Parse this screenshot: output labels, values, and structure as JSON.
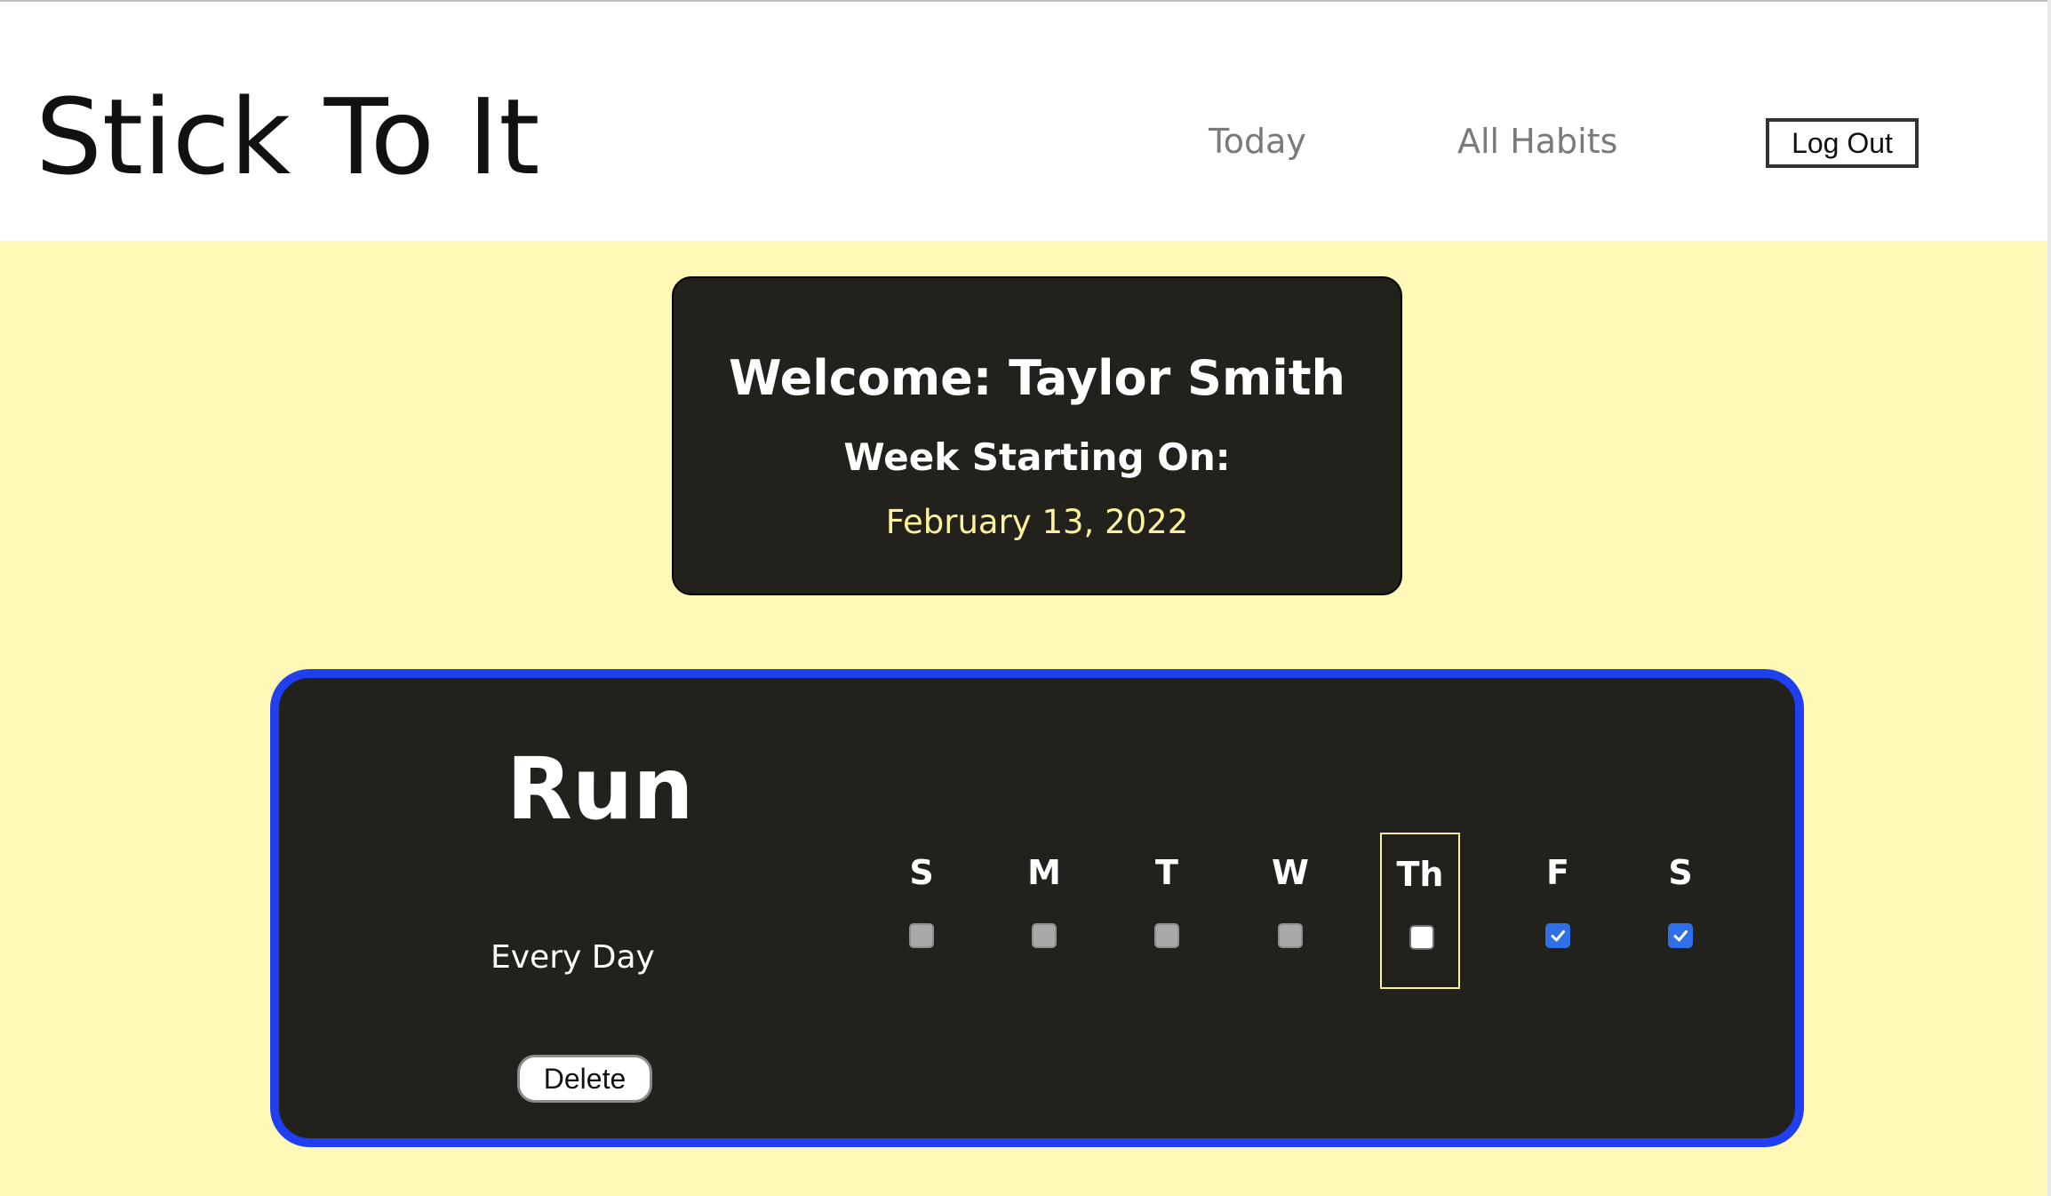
{
  "app": {
    "title": "Stick To It"
  },
  "nav": {
    "today": "Today",
    "all_habits": "All Habits",
    "logout": "Log Out"
  },
  "welcome": {
    "title": "Welcome: Taylor Smith",
    "week_label": "Week Starting On:",
    "week_date": "February 13, 2022"
  },
  "habit": {
    "name": "Run",
    "frequency": "Every Day",
    "delete_label": "Delete",
    "days": [
      {
        "label": "S",
        "state": "disabled",
        "today": false
      },
      {
        "label": "M",
        "state": "disabled",
        "today": false
      },
      {
        "label": "T",
        "state": "disabled",
        "today": false
      },
      {
        "label": "W",
        "state": "disabled",
        "today": false
      },
      {
        "label": "Th",
        "state": "unchecked",
        "today": true
      },
      {
        "label": "F",
        "state": "checked",
        "today": false
      },
      {
        "label": "S",
        "state": "checked",
        "today": false
      }
    ]
  },
  "colors": {
    "background": "#fef9b7",
    "card": "#22211b",
    "accent_border": "#1f3ff0",
    "highlight_text": "#fdf29c",
    "checkbox_checked": "#2f6fe8",
    "checkbox_disabled": "#a9a9a9"
  }
}
